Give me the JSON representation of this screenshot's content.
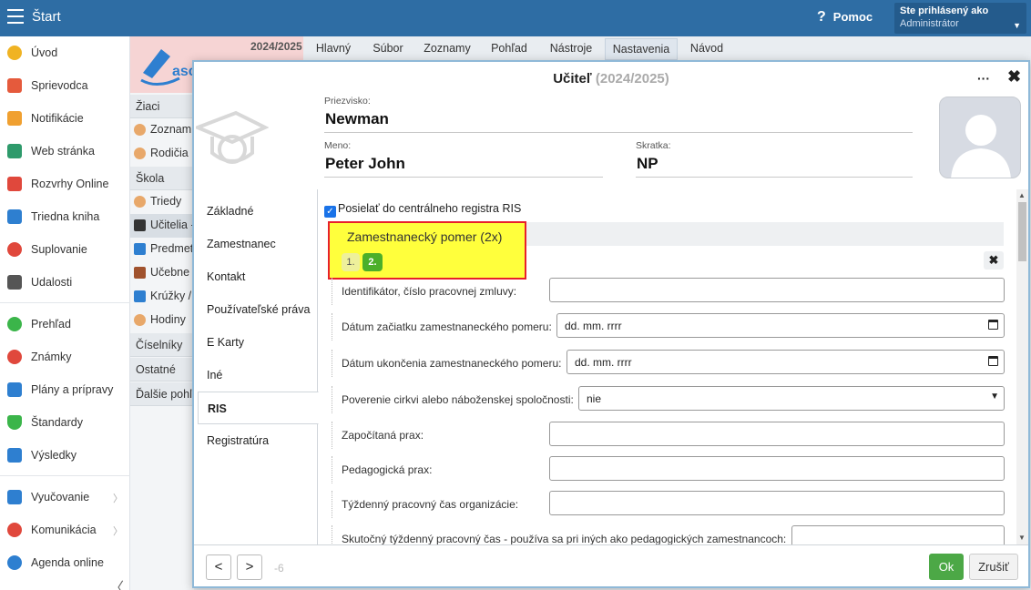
{
  "topbar": {
    "title": "Štart",
    "help": "Pomoc",
    "user_line1": "Ste prihlásený ako",
    "user_line2": "Administrátor"
  },
  "sidebar": {
    "items": [
      {
        "label": "Úvod",
        "color": "#f0b323"
      },
      {
        "label": "Sprievodca",
        "color": "#e55a3c"
      },
      {
        "label": "Notifikácie",
        "color": "#f0a030"
      },
      {
        "label": "Web stránka",
        "color": "#2e9a6b"
      },
      {
        "label": "Rozvrhy Online",
        "color": "#e0483c"
      },
      {
        "label": "Triedna kniha",
        "color": "#2e7fd0"
      },
      {
        "label": "Suplovanie",
        "color": "#e0483c"
      },
      {
        "label": "Udalosti",
        "color": "#555555"
      },
      {
        "label": "Prehľad",
        "color": "#3bb54a"
      },
      {
        "label": "Známky",
        "color": "#e0483c"
      },
      {
        "label": "Plány a prípravy",
        "color": "#2e7fd0"
      },
      {
        "label": "Štandardy",
        "color": "#3bb54a"
      },
      {
        "label": "Výsledky",
        "color": "#2e7fd0"
      },
      {
        "label": "Vyučovanie",
        "color": "#2e7fd0"
      },
      {
        "label": "Komunikácia",
        "color": "#e0483c"
      },
      {
        "label": "Agenda online",
        "color": "#2e7fd0"
      }
    ]
  },
  "midpanel": {
    "year": "2024/2025",
    "logo_text": "asc",
    "heads": [
      "Žiaci",
      "Škola",
      "Číselníky",
      "Ostatné",
      "Ďalšie pohľ"
    ],
    "items": [
      "Zoznam",
      "Rodičia",
      "Triedy",
      "Učitelia -",
      "Predmet",
      "Učebne",
      "Krúžky /",
      "Hodiny"
    ]
  },
  "topmenu": [
    "Hlavný",
    "Súbor",
    "Zoznamy",
    "Pohľad",
    "Nástroje",
    "Nastavenia",
    "Návod"
  ],
  "dialog": {
    "title": "Učiteľ",
    "year": "(2024/2025)",
    "more": "···",
    "close": "✖",
    "surname_label": "Priezvisko:",
    "surname": "Newman",
    "name_label": "Meno:",
    "name": "Peter John",
    "abbr_label": "Skratka:",
    "abbr": "NP",
    "tabs": [
      "Základné",
      "Zamestnanec",
      "Kontakt",
      "Používateľské práva",
      "E Karty",
      "Iné",
      "RIS",
      "Registratúra"
    ],
    "active_tab": "RIS",
    "checkbox_label": "Posielať do centrálneho registra RIS",
    "section_title": "Zamestnanecký pomer (2x)",
    "pill1": "1.",
    "pill2": "2.",
    "fields": [
      {
        "label": "Identifikátor, číslo pracovnej zmluvy:",
        "value": ""
      },
      {
        "label": "Dátum začiatku zamestnaneckého pomeru:",
        "value": "dd. mm. rrrr"
      },
      {
        "label": "Dátum ukončenia zamestnaneckého pomeru:",
        "value": "dd. mm. rrrr"
      },
      {
        "label": "Poverenie cirkvi alebo náboženskej spoločnosti:",
        "value": "nie"
      },
      {
        "label": "Započítaná prax:",
        "value": ""
      },
      {
        "label": "Pedagogická prax:",
        "value": ""
      },
      {
        "label": "Týždenný pracovný čas organizácie:",
        "value": ""
      },
      {
        "label": "Skutočný týždenný pracovný čas - používa sa pri iných ako pedagogických zamestnancoch:",
        "value": ""
      }
    ],
    "footer_num": "-6",
    "ok": "Ok",
    "cancel": "Zrušiť"
  }
}
